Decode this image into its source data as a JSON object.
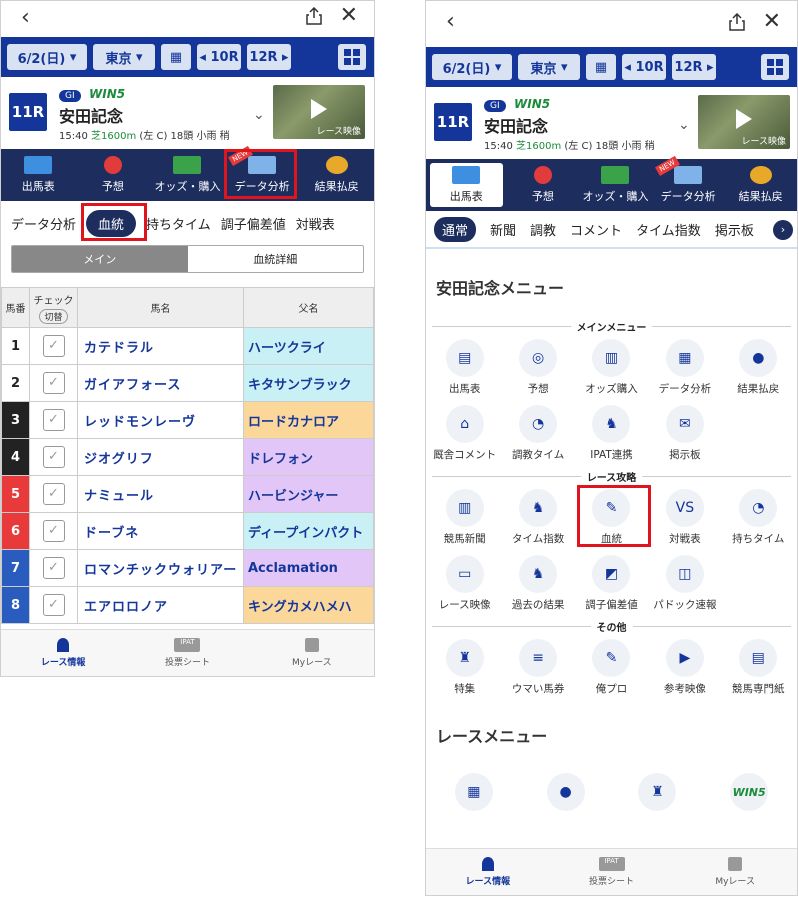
{
  "left": {
    "nav": {
      "date": "6/2(日)",
      "venue": "東京",
      "prev": "10R",
      "next": "12R"
    },
    "race": {
      "num": "11R",
      "grade": "GI",
      "win5": "WIN5",
      "name": "安田記念",
      "info_time": "15:40",
      "info_course": "芝1600m",
      "info_rest": "(左 C) 18頭 小雨 稍",
      "video_label": "レース映像"
    },
    "menu": [
      "出馬表",
      "予想",
      "オッズ・購入",
      "データ分析",
      "結果払戻"
    ],
    "new_tag": "NEW",
    "subtabs": [
      "データ分析",
      "血統",
      "持ちタイム",
      "調子偏差値",
      "対戦表"
    ],
    "segment": [
      "メイン",
      "血統詳細"
    ],
    "table": {
      "head": {
        "num": "馬番",
        "check": "チェック",
        "toggle": "切替",
        "horse": "馬名",
        "sire": "父名"
      },
      "rows": [
        {
          "n": "1",
          "horse": "カテドラル",
          "sire": "ハーツクライ",
          "fc": "#ffffff",
          "fg": "#222",
          "sc": "#c9f0f5"
        },
        {
          "n": "2",
          "horse": "ガイアフォース",
          "sire": "キタサンブラック",
          "fc": "#ffffff",
          "fg": "#222",
          "sc": "#c9f0f5"
        },
        {
          "n": "3",
          "horse": "レッドモンレーヴ",
          "sire": "ロードカナロア",
          "fc": "#222222",
          "fg": "#fff",
          "sc": "#fcd79a"
        },
        {
          "n": "4",
          "horse": "ジオグリフ",
          "sire": "ドレフォン",
          "fc": "#222222",
          "fg": "#fff",
          "sc": "#e2c6f7"
        },
        {
          "n": "5",
          "horse": "ナミュール",
          "sire": "ハービンジャー",
          "fc": "#e83a3a",
          "fg": "#fff",
          "sc": "#e2c6f7"
        },
        {
          "n": "6",
          "horse": "ドーブネ",
          "sire": "ディープインパクト",
          "fc": "#e83a3a",
          "fg": "#fff",
          "sc": "#c9f0f5"
        },
        {
          "n": "7",
          "horse": "ロマンチックウォリアー",
          "sire": "Acclamation",
          "fc": "#2a5bbf",
          "fg": "#fff",
          "sc": "#e2c6f7"
        },
        {
          "n": "8",
          "horse": "エアロロノア",
          "sire": "キングカメハメハ",
          "fc": "#2a5bbf",
          "fg": "#fff",
          "sc": "#fcd79a"
        }
      ]
    },
    "bottom": [
      "レース情報",
      "投票シート",
      "Myレース"
    ],
    "ipat": "IPAT"
  },
  "right": {
    "tabs": [
      "通常",
      "新聞",
      "調教",
      "コメント",
      "タイム指数",
      "掲示板"
    ],
    "section_title": "安田記念メニュー",
    "groups": [
      {
        "title": "メインメニュー",
        "items": [
          "出馬表",
          "予想",
          "オッズ購入",
          "データ分析",
          "結果払戻",
          "厩舎コメント",
          "調教タイム",
          "IPAT連携",
          "掲示板"
        ]
      },
      {
        "title": "レース攻略",
        "items": [
          "競馬新聞",
          "タイム指数",
          "血統",
          "対戦表",
          "持ちタイム",
          "レース映像",
          "過去の結果",
          "調子偏差値",
          "パドック速報"
        ]
      },
      {
        "title": "その他",
        "items": [
          "特集",
          "ウマい馬券",
          "俺プロ",
          "参考映像",
          "競馬専門紙"
        ]
      }
    ],
    "race_menu_title": "レースメニュー",
    "umai_logo": "ウマい馬券",
    "win5": "WIN5"
  },
  "colors": {
    "navy": "#14369a",
    "dark": "#1c2d5e",
    "highlight": "#e0141c",
    "green": "#1a8c3a"
  }
}
